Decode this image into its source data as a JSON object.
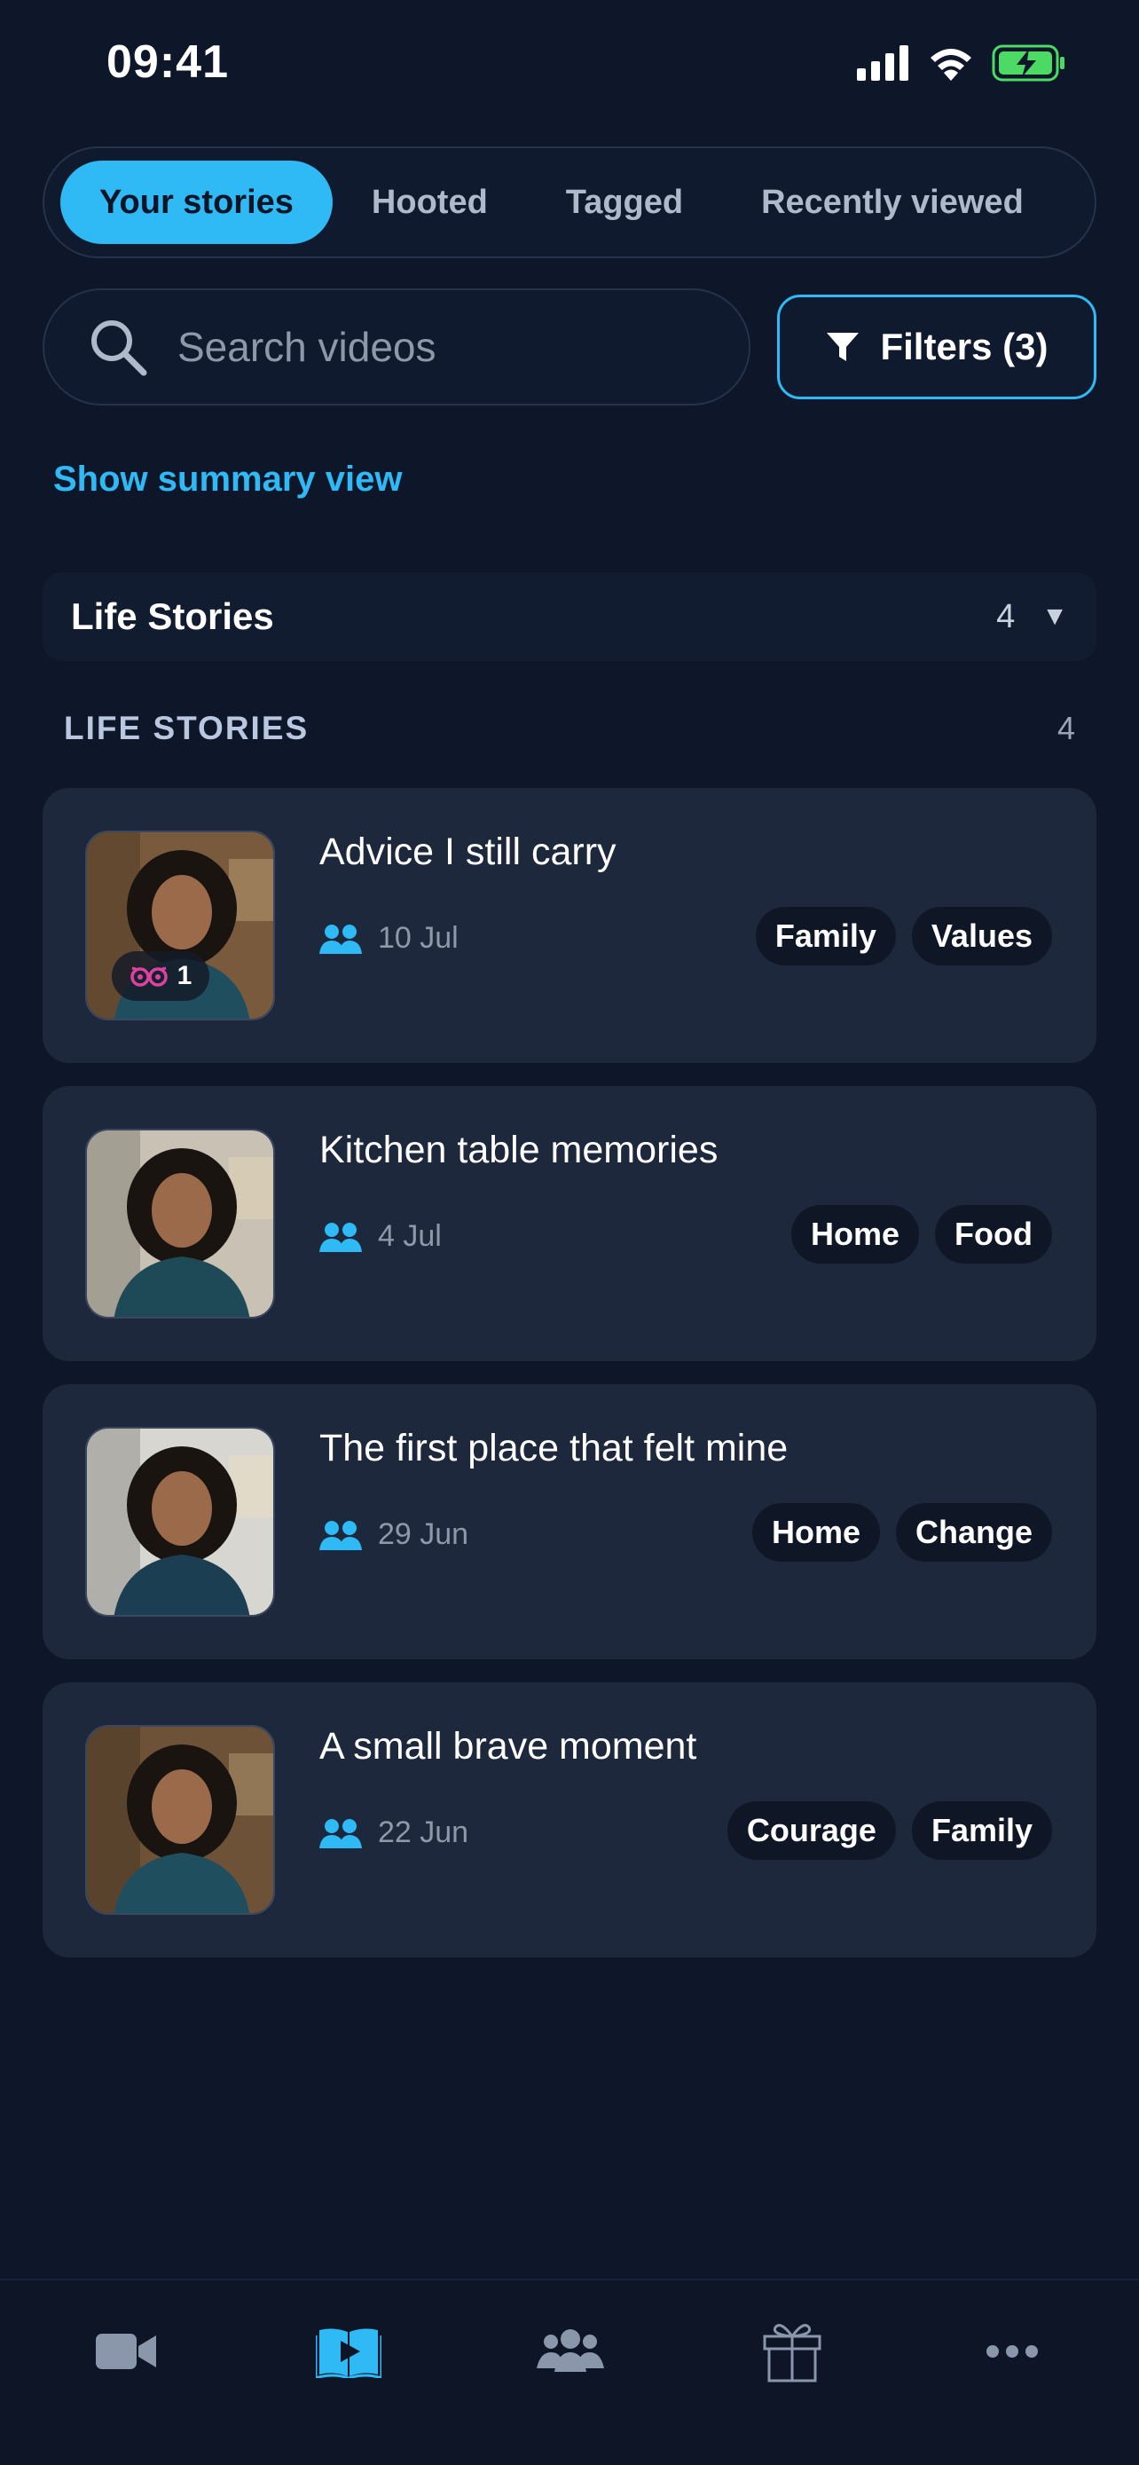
{
  "status_bar": {
    "time": "09:41"
  },
  "tabs": [
    {
      "label": "Your stories",
      "active": true
    },
    {
      "label": "Hooted",
      "active": false
    },
    {
      "label": "Tagged",
      "active": false
    },
    {
      "label": "Recently viewed",
      "active": false
    }
  ],
  "search": {
    "placeholder": "Search videos",
    "value": ""
  },
  "filters": {
    "label": "Filters (3)"
  },
  "summary_link": "Show summary view",
  "group_dropdown": {
    "title": "Life Stories",
    "count": "4"
  },
  "section": {
    "label": "LIFE STORIES",
    "count": "4"
  },
  "stories": [
    {
      "title": "Advice I still carry",
      "date": "10 Jul",
      "tags": [
        "Family",
        "Values"
      ],
      "hoots": "1",
      "sweater": "#1f4f5e",
      "wall": "#7a5a3c"
    },
    {
      "title": "Kitchen table memories",
      "date": "4 Jul",
      "tags": [
        "Home",
        "Food"
      ],
      "hoots": null,
      "sweater": "#1e4a57",
      "wall": "#c9c2b4"
    },
    {
      "title": "The first place that felt mine",
      "date": "29 Jun",
      "tags": [
        "Home",
        "Change"
      ],
      "hoots": null,
      "sweater": "#1c3e52",
      "wall": "#d8d6d0"
    },
    {
      "title": "A small brave moment",
      "date": "22 Jun",
      "tags": [
        "Courage",
        "Family"
      ],
      "hoots": null,
      "sweater": "#1f4f5e",
      "wall": "#6e5238"
    }
  ],
  "colors": {
    "accent": "#2fb9f5",
    "background": "#0e1729",
    "card": "#1d283c",
    "owl": "#e040a0"
  },
  "bottom_nav": [
    {
      "icon": "video-camera-icon",
      "active": false
    },
    {
      "icon": "stories-book-icon",
      "active": true
    },
    {
      "icon": "people-group-icon",
      "active": false
    },
    {
      "icon": "gift-icon",
      "active": false
    },
    {
      "icon": "more-dots-icon",
      "active": false
    }
  ]
}
